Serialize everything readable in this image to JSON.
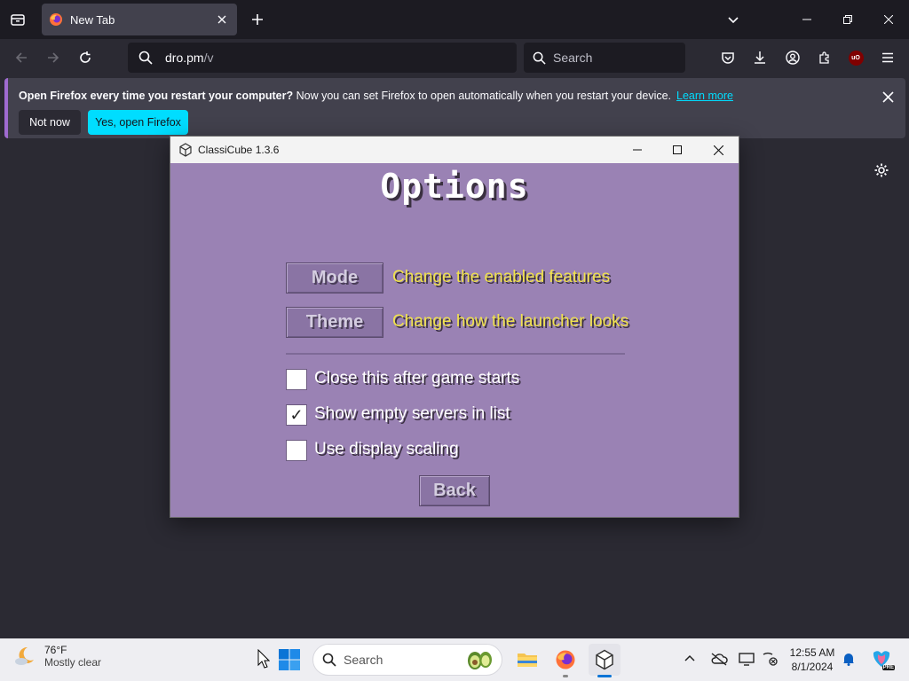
{
  "browser": {
    "tab": {
      "title": "New Tab"
    },
    "url": {
      "host": "dro.pm",
      "path": "/v"
    },
    "search": {
      "placeholder": "Search"
    },
    "infobar": {
      "bold": "Open Firefox every time you restart your computer?",
      "text": " Now you can set Firefox to open automatically when you restart your device.",
      "learn_more": "Learn more",
      "not_now": "Not now",
      "yes": "Yes, open Firefox"
    }
  },
  "app": {
    "window_title": "ClassiCube 1.3.6",
    "heading": "Options",
    "buttons": [
      {
        "label": "Mode",
        "description": "Change the enabled features"
      },
      {
        "label": "Theme",
        "description": "Change how the launcher looks"
      }
    ],
    "checkboxes": [
      {
        "label": "Close this after game starts",
        "checked": false
      },
      {
        "label": "Show empty servers in list",
        "checked": true
      },
      {
        "label": "Use display scaling",
        "checked": false
      }
    ],
    "checkmark": "✓",
    "back": "Back"
  },
  "taskbar": {
    "weather": {
      "temp": "76°F",
      "desc": "Mostly clear"
    },
    "search_placeholder": "Search",
    "clock": {
      "time": "12:55 AM",
      "date": "8/1/2024"
    },
    "copilot_badge": "PRE"
  },
  "colors": {
    "accent": "#00ddff",
    "launcher_bg": "#9a82b4",
    "launcher_desc": "#f0e24c"
  }
}
